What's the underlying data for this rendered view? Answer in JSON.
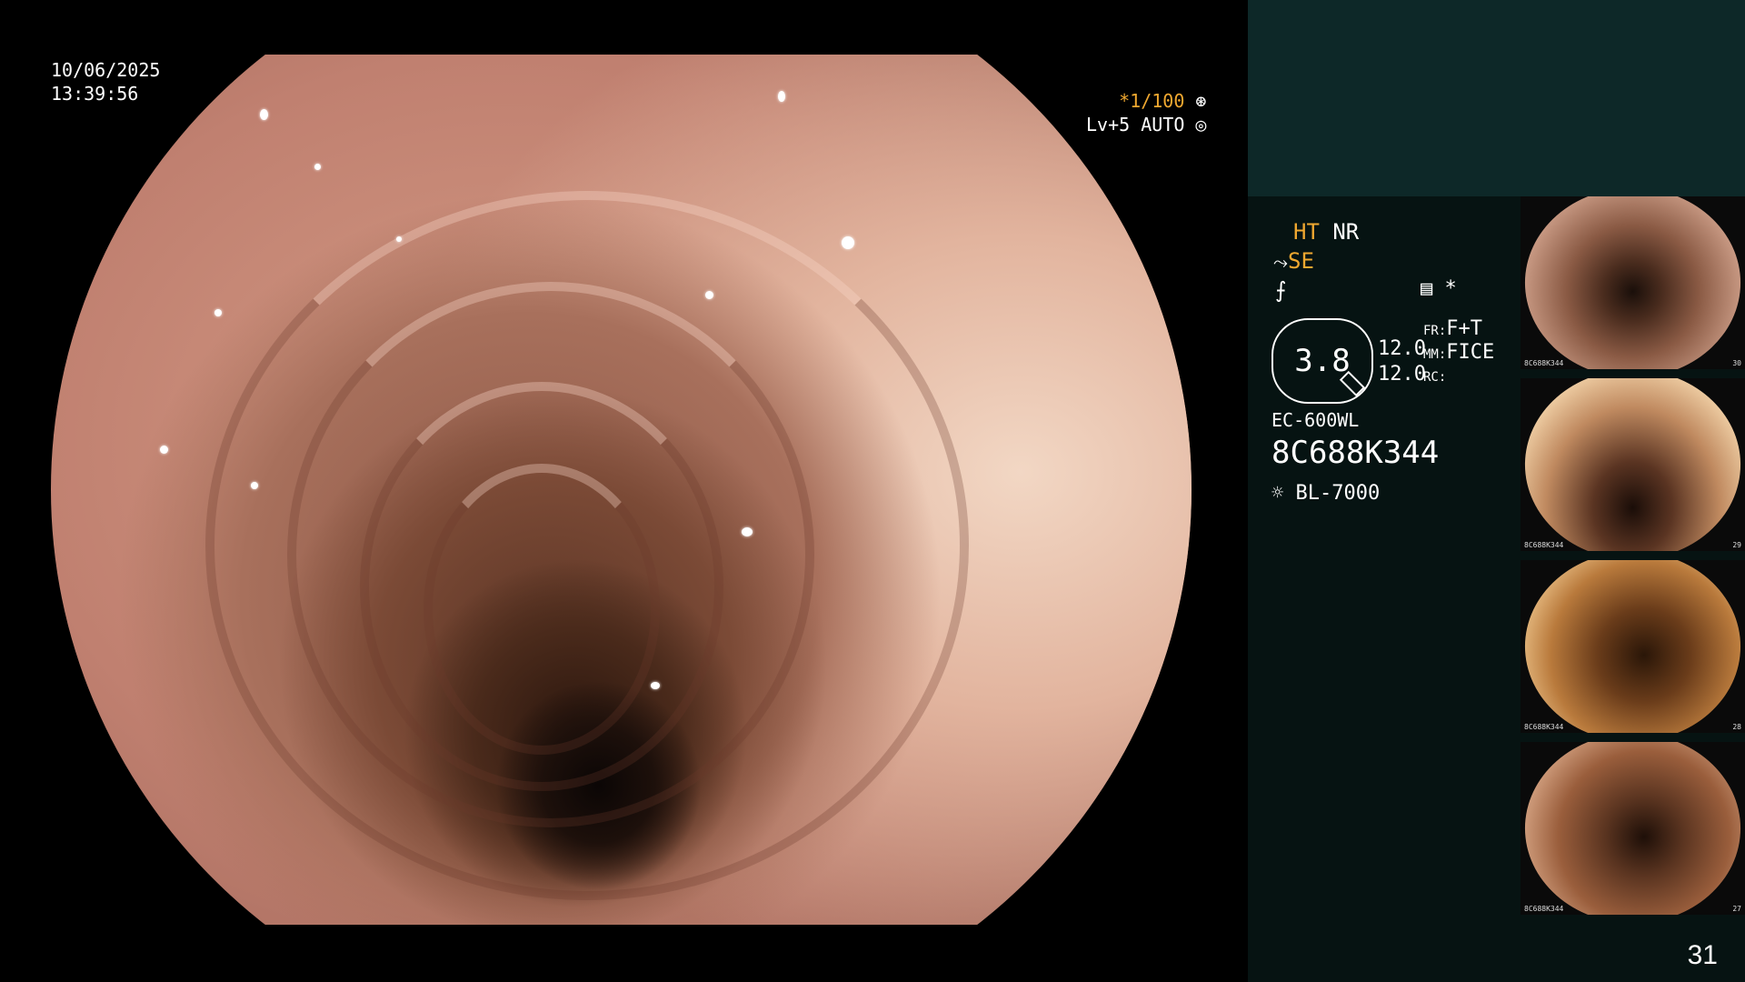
{
  "main": {
    "date": "10/06/2025",
    "time": "13:39:56",
    "shutter": "*1/100",
    "level": "Lv+5 AUTO"
  },
  "panel": {
    "mode_ht": "HT",
    "mode_nr": "NR",
    "mode_se": "SE",
    "zoom_value": "3.8",
    "value_1": "12.0",
    "value_2": "12.0",
    "fr_label": "FR:",
    "fr_value": "F+T",
    "mm_label": "MM:",
    "mm_value": "FICE",
    "rc_label": "RC:",
    "scope_model": "EC-600WL",
    "scope_serial": "8C688K344",
    "light_source": "BL-7000",
    "page_number": "31",
    "icons": [
      "scissors-icon",
      "no-sign-icon",
      "list-icon",
      "star-icon",
      "sun-icon",
      "aperture-icon"
    ]
  },
  "thumbnails": [
    {
      "id": "8C688K344",
      "index": "30"
    },
    {
      "id": "8C688K344",
      "index": "29"
    },
    {
      "id": "8C688K344",
      "index": "28"
    },
    {
      "id": "8C688K344",
      "index": "27"
    }
  ]
}
